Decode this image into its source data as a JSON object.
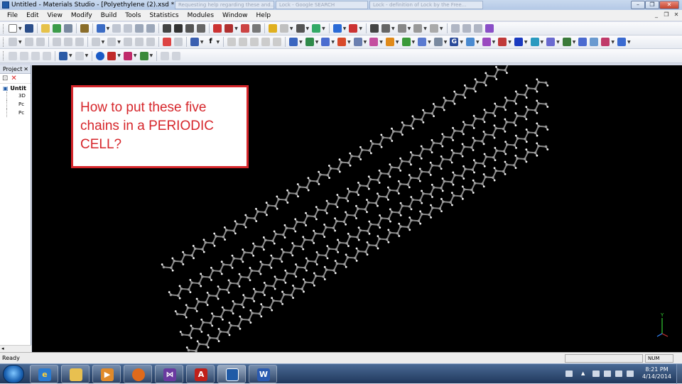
{
  "window": {
    "title": "Untitled - Materials Studio - [Polyethylene (2).xsd *]",
    "background_tabs": [
      "Requesting help regarding these and...",
      "Lock - Google SEARCH",
      "Lock - definition of Lock by the Free..."
    ]
  },
  "menu": [
    "File",
    "Edit",
    "View",
    "Modify",
    "Build",
    "Tools",
    "Statistics",
    "Modules",
    "Window",
    "Help"
  ],
  "project_panel": {
    "title": "Project",
    "root": "Untit",
    "items": [
      "3D",
      "Pc",
      "Pc"
    ]
  },
  "viewport": {
    "callout_text": "How to put these five chains in a PERIODIC CELL?",
    "axis_label": "Y"
  },
  "status": {
    "text": "Ready",
    "num": "NUM"
  },
  "taskbar": {
    "apps": [
      "ie-icon",
      "explorer-icon",
      "media-player-icon",
      "firefox-icon",
      "visual-studio-icon",
      "acrobat-icon",
      "materials-studio-icon",
      "word-icon"
    ],
    "time": "8:21 PM",
    "date": "4/14/2014"
  },
  "colors": {
    "callout_border": "#d6262b",
    "callout_text": "#d6262b",
    "viewport_bg": "#000000"
  }
}
